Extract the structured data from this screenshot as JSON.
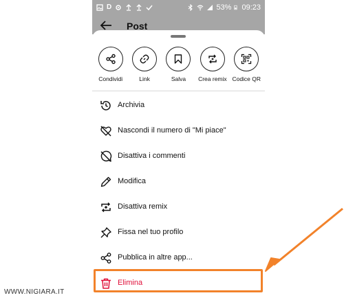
{
  "status_bar": {
    "battery": "53%",
    "time": "09:23",
    "left_icons": [
      "image-icon",
      "d-icon",
      "gear-icon",
      "upload-icon",
      "upload-icon",
      "check-icon"
    ],
    "right_icons": [
      "bluetooth-icon",
      "wifi-icon",
      "signal-icon",
      "battery-icon"
    ]
  },
  "header": {
    "title": "Post"
  },
  "actions": [
    {
      "label": "Condividi",
      "icon": "share-icon"
    },
    {
      "label": "Link",
      "icon": "link-icon"
    },
    {
      "label": "Salva",
      "icon": "bookmark-icon"
    },
    {
      "label": "Crea remix",
      "icon": "remix-icon"
    },
    {
      "label": "Codice QR",
      "icon": "qr-icon"
    }
  ],
  "menu": [
    {
      "label": "Archivia",
      "icon": "archive-clock-icon"
    },
    {
      "label": "Nascondi il numero di \"Mi piace\"",
      "icon": "heart-off-icon"
    },
    {
      "label": "Disattiva i commenti",
      "icon": "comment-off-icon"
    },
    {
      "label": "Modifica",
      "icon": "pencil-icon"
    },
    {
      "label": "Disattiva remix",
      "icon": "remix-icon"
    },
    {
      "label": "Fissa nel tuo profilo",
      "icon": "pin-icon"
    },
    {
      "label": "Pubblica in altre app...",
      "icon": "share-icon"
    },
    {
      "label": "Elimina",
      "icon": "trash-icon"
    }
  ],
  "colors": {
    "danger": "#e0103a",
    "annotation": "#f2822a",
    "status_bar": "#a6a6a6"
  },
  "watermark": "WWW.NIGIARA.IT"
}
